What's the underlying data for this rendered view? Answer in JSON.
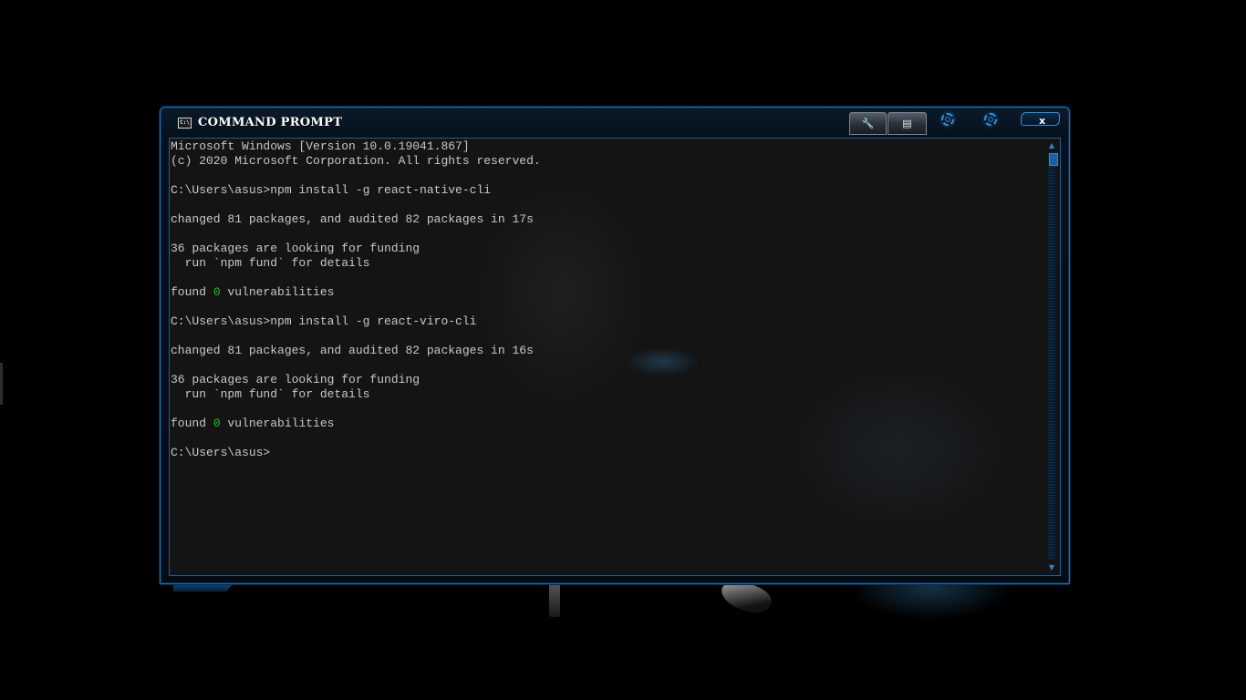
{
  "window": {
    "title": "COMMAND PROMPT",
    "icon": "cmd-icon",
    "icon_label": "C:\\",
    "buttons": {
      "tools_icon": "wrench-icon",
      "tools_glyph": "🔧",
      "props_icon": "properties-icon",
      "props_glyph": "▤",
      "gear1_icon": "gear-icon",
      "gear2_icon": "gear-icon",
      "close_label": "x"
    },
    "colors": {
      "accent": "#2f8fe0",
      "border": "#1f6fb3",
      "console_bg": "#141414",
      "text": "#c8c8c8",
      "highlight_green": "#22c01e"
    }
  },
  "console": {
    "lines": [
      {
        "text": "Microsoft Windows [Version 10.0.19041.867]"
      },
      {
        "text": "(c) 2020 Microsoft Corporation. All rights reserved."
      },
      {
        "text": ""
      },
      {
        "text": "C:\\Users\\asus>npm install -g react-native-cli"
      },
      {
        "text": ""
      },
      {
        "text": "changed 81 packages, and audited 82 packages in 17s"
      },
      {
        "text": ""
      },
      {
        "text": "36 packages are looking for funding"
      },
      {
        "text": "  run `npm fund` for details"
      },
      {
        "text": ""
      },
      {
        "pre": "found ",
        "highlight": "0",
        "post": " vulnerabilities"
      },
      {
        "text": ""
      },
      {
        "text": "C:\\Users\\asus>npm install -g react-viro-cli"
      },
      {
        "text": ""
      },
      {
        "text": "changed 81 packages, and audited 82 packages in 16s"
      },
      {
        "text": ""
      },
      {
        "text": "36 packages are looking for funding"
      },
      {
        "text": "  run `npm fund` for details"
      },
      {
        "text": ""
      },
      {
        "pre": "found ",
        "highlight": "0",
        "post": " vulnerabilities"
      },
      {
        "text": ""
      },
      {
        "text": "C:\\Users\\asus>"
      }
    ],
    "scroll": {
      "up_glyph": "▲",
      "down_glyph": "▼",
      "position": 0
    }
  }
}
